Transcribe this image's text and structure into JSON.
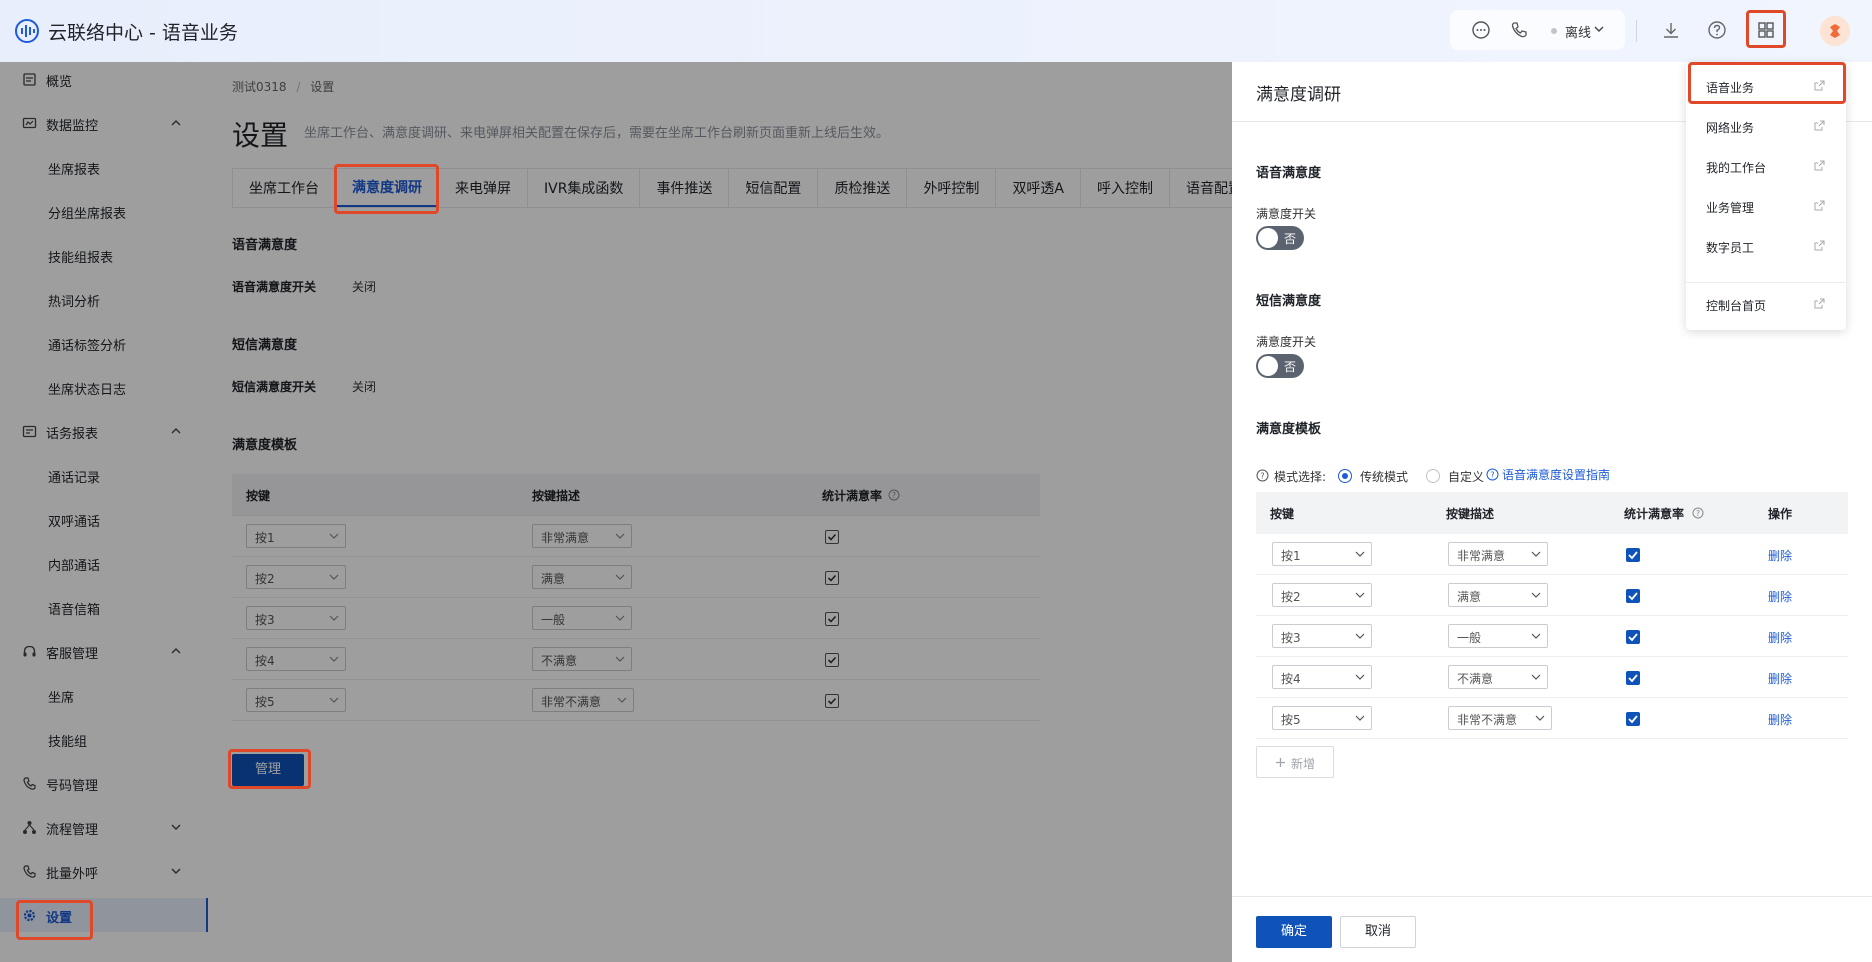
{
  "header": {
    "title": "云联络中心 - 语音业务",
    "status": "离线"
  },
  "sidebar": {
    "items": [
      {
        "label": "概览",
        "icon": "overview-icon",
        "level": 0
      },
      {
        "label": "数据监控",
        "icon": "monitor-icon",
        "level": 0,
        "expanded": true
      },
      {
        "label": "坐席报表",
        "level": 1
      },
      {
        "label": "分组坐席报表",
        "level": 1
      },
      {
        "label": "技能组报表",
        "level": 1
      },
      {
        "label": "热词分析",
        "level": 1
      },
      {
        "label": "通话标签分析",
        "level": 1
      },
      {
        "label": "坐席状态日志",
        "level": 1
      },
      {
        "label": "话务报表",
        "icon": "report-icon",
        "level": 0,
        "expanded": true
      },
      {
        "label": "通话记录",
        "level": 1
      },
      {
        "label": "双呼通话",
        "level": 1
      },
      {
        "label": "内部通话",
        "level": 1
      },
      {
        "label": "语音信箱",
        "level": 1
      },
      {
        "label": "客服管理",
        "icon": "headset-icon",
        "level": 0,
        "expanded": true
      },
      {
        "label": "坐席",
        "level": 1
      },
      {
        "label": "技能组",
        "level": 1
      },
      {
        "label": "号码管理",
        "icon": "phone-icon",
        "level": 0
      },
      {
        "label": "流程管理",
        "icon": "flow-icon",
        "level": 0,
        "expanded": false
      },
      {
        "label": "批量外呼",
        "icon": "outbound-icon",
        "level": 0,
        "expanded": false
      },
      {
        "label": "设置",
        "icon": "gear-icon",
        "level": 0,
        "active": true
      }
    ]
  },
  "main": {
    "breadcrumb": [
      "测试0318",
      "/",
      "设置"
    ],
    "title": "设置",
    "hint": "坐席工作台、满意度调研、来电弹屏相关配置在保存后，需要在坐席工作台刷新页面重新上线后生效。",
    "tabs": [
      "坐席工作台",
      "满意度调研",
      "来电弹屏",
      "IVR集成函数",
      "事件推送",
      "短信配置",
      "质检推送",
      "外呼控制",
      "双呼透A",
      "呼入控制",
      "语音配置"
    ],
    "active_tab": 1,
    "voice_section": "语音满意度",
    "voice_switch_label": "语音满意度开关",
    "voice_switch_value": "关闭",
    "sms_section": "短信满意度",
    "sms_switch_label": "短信满意度开关",
    "sms_switch_value": "关闭",
    "template_section": "满意度模板",
    "table_headers": [
      "按键",
      "按键描述",
      "统计满意率"
    ],
    "rows": [
      {
        "key": "按1",
        "desc": "非常满意"
      },
      {
        "key": "按2",
        "desc": "满意"
      },
      {
        "key": "按3",
        "desc": "一般"
      },
      {
        "key": "按4",
        "desc": "不满意"
      },
      {
        "key": "按5",
        "desc": "非常不满意"
      }
    ],
    "manage_label": "管理"
  },
  "drawer": {
    "title": "满意度调研",
    "voice_section": "语音满意度",
    "voice_switch_label": "满意度开关",
    "voice_switch_text": "否",
    "sms_section": "短信满意度",
    "sms_switch_label": "满意度开关",
    "sms_switch_text": "否",
    "template_section": "满意度模板",
    "mode_label": "模式选择:",
    "mode_traditional": "传统模式",
    "mode_custom": "自定义",
    "guide_link": "语音满意度设置指南",
    "table_headers": [
      "按键",
      "按键描述",
      "统计满意率",
      "操作"
    ],
    "rows": [
      {
        "key": "按1",
        "desc": "非常满意",
        "action": "删除"
      },
      {
        "key": "按2",
        "desc": "满意",
        "action": "删除"
      },
      {
        "key": "按3",
        "desc": "一般",
        "action": "删除"
      },
      {
        "key": "按4",
        "desc": "不满意",
        "action": "删除"
      },
      {
        "key": "按5",
        "desc": "非常不满意",
        "action": "删除"
      }
    ],
    "add_label": "新增",
    "confirm_label": "确定",
    "cancel_label": "取消"
  },
  "menu": {
    "items": [
      "语音业务",
      "网络业务",
      "我的工作台",
      "业务管理",
      "数字员工"
    ],
    "console": "控制台首页"
  },
  "colors": {
    "primary": "#0f52ba",
    "highlight": "#e0482a",
    "link": "#1e5bd7"
  }
}
